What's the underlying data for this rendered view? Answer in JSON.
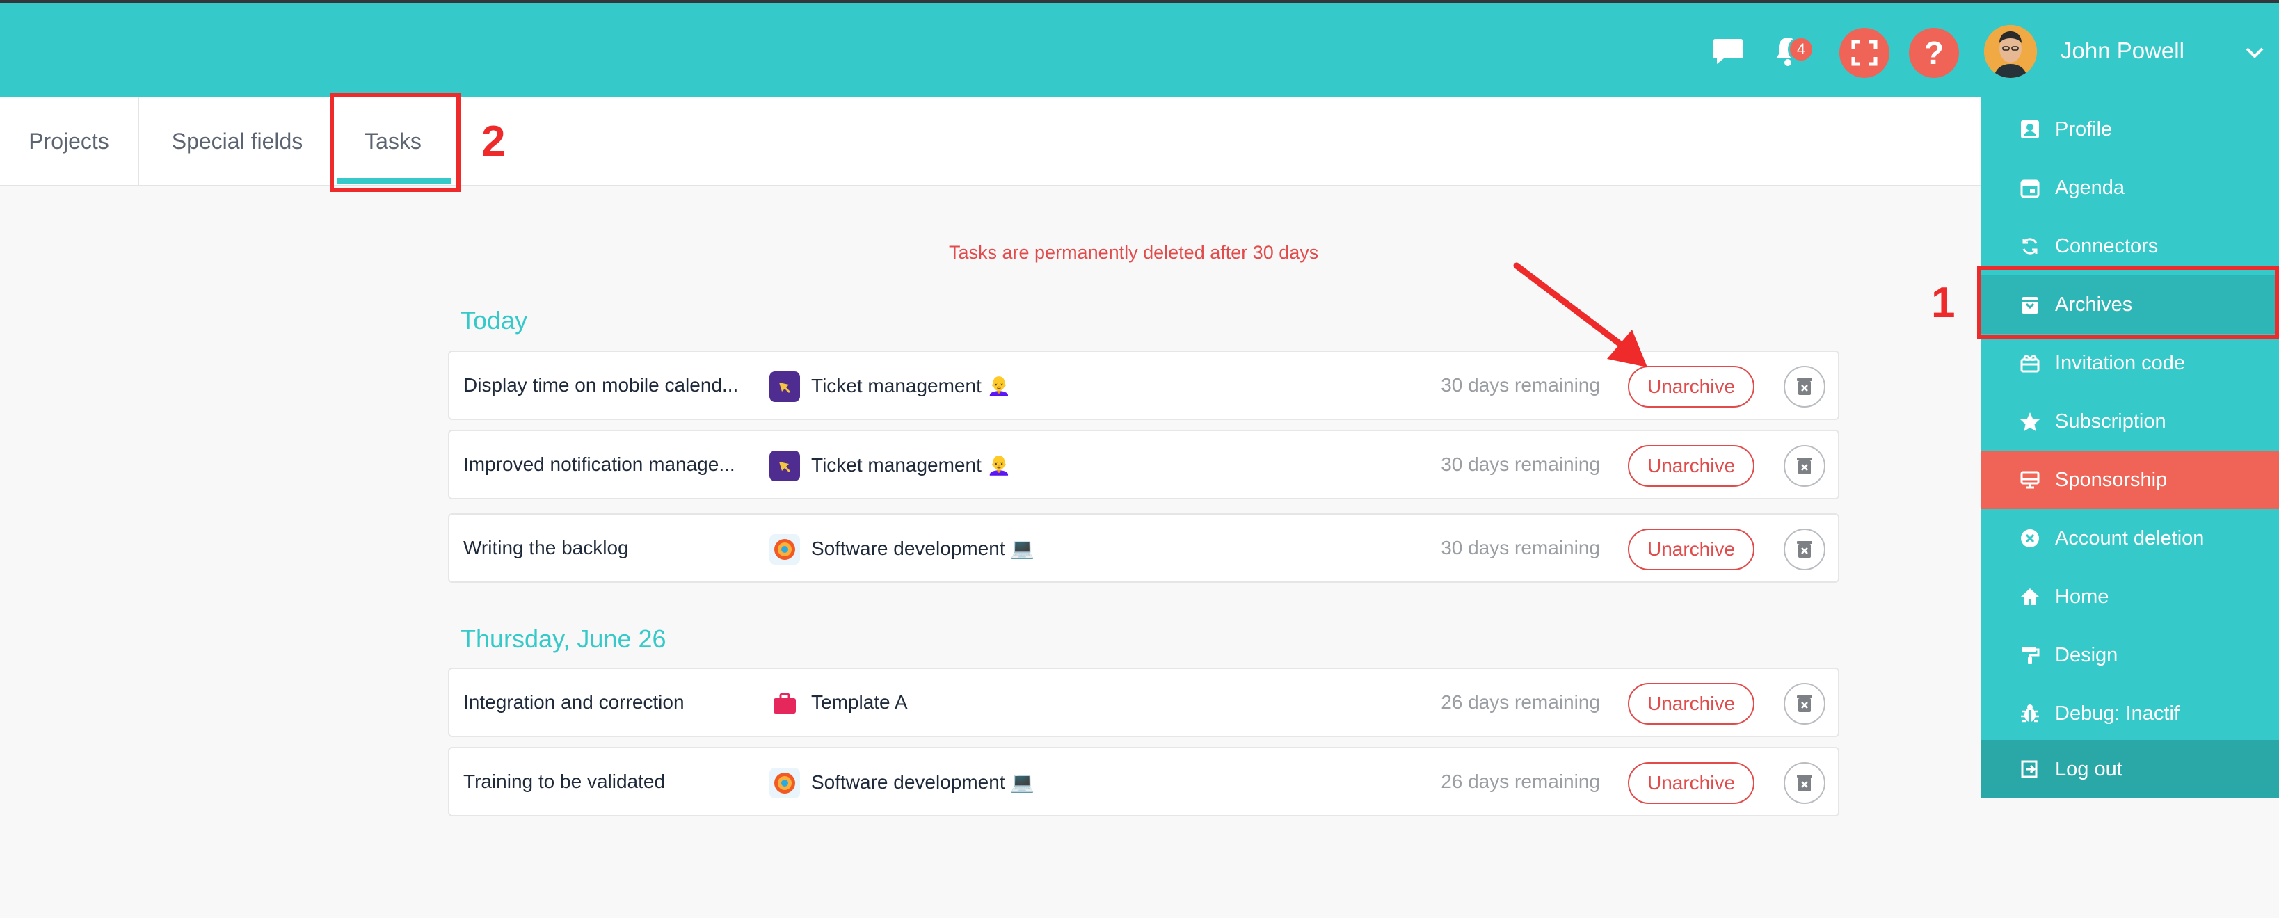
{
  "header": {
    "notification_count": "4",
    "help_label": "?",
    "user_name": "John Powell"
  },
  "tabs": [
    {
      "label": "Projects"
    },
    {
      "label": "Special fields"
    },
    {
      "label": "Tasks",
      "active": true
    }
  ],
  "annotations": {
    "tasks_marker": "2",
    "archives_marker": "1"
  },
  "notice": "Tasks are permanently deleted after 30 days",
  "groups": [
    {
      "title": "Today",
      "tasks": [
        {
          "name": "Display time on mobile calend...",
          "project": "Ticket management",
          "project_emoji": "👩‍🦲",
          "remaining": "30 days remaining",
          "action": "Unarchive"
        },
        {
          "name": "Improved notification manage...",
          "project": "Ticket management",
          "project_emoji": "👩‍🦲",
          "remaining": "30 days remaining",
          "action": "Unarchive"
        },
        {
          "name": "Writing the backlog",
          "project": "Software development",
          "project_emoji": "💻",
          "remaining": "30 days remaining",
          "action": "Unarchive"
        }
      ]
    },
    {
      "title": "Thursday, June 26",
      "tasks": [
        {
          "name": "Integration and correction",
          "project": "Template A",
          "project_emoji": "",
          "remaining": "26 days remaining",
          "action": "Unarchive"
        },
        {
          "name": "Training to be validated",
          "project": "Software development",
          "project_emoji": "💻",
          "remaining": "26 days remaining",
          "action": "Unarchive"
        }
      ]
    }
  ],
  "menu": {
    "items": [
      {
        "label": "Profile",
        "icon": "profile-icon"
      },
      {
        "label": "Agenda",
        "icon": "calendar-icon"
      },
      {
        "label": "Connectors",
        "icon": "sync-icon"
      },
      {
        "label": "Archives",
        "icon": "archive-icon"
      },
      {
        "label": "Invitation code",
        "icon": "gift-icon"
      },
      {
        "label": "Subscription",
        "icon": "star-icon"
      },
      {
        "label": "Sponsorship",
        "icon": "monitor-icon"
      },
      {
        "label": "Account deletion",
        "icon": "close-circle-icon"
      },
      {
        "label": "Home",
        "icon": "home-icon"
      },
      {
        "label": "Design",
        "icon": "paint-roller-icon"
      },
      {
        "label": "Debug: Inactif",
        "icon": "bug-icon"
      },
      {
        "label": "Log out",
        "icon": "logout-icon"
      }
    ]
  },
  "colors": {
    "primary": "#35c9c9",
    "accent": "#ef6456",
    "danger_text": "#e14b4b",
    "annotation_red": "#ee2a2a"
  }
}
